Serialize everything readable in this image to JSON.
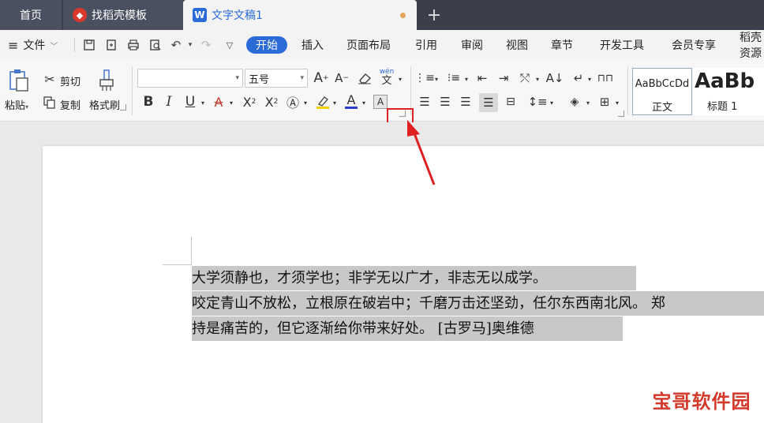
{
  "tabs": {
    "home": "首页",
    "templates": "找稻壳模板",
    "document": "文字文稿1",
    "add": "+"
  },
  "menu": {
    "file": "文件",
    "items": [
      "开始",
      "插入",
      "页面布局",
      "引用",
      "审阅",
      "视图",
      "章节",
      "开发工具",
      "会员专享",
      "稻壳资源"
    ]
  },
  "ribbon": {
    "paste": "粘贴",
    "cut": "剪切",
    "copy": "复制",
    "format_painter": "格式刷",
    "font_name": "",
    "font_size": "五号",
    "pinyin": "wén",
    "styles": [
      {
        "sample": "AaBbCcDd",
        "label": "正文"
      },
      {
        "sample": "AaBb",
        "label": "标题 1"
      }
    ]
  },
  "document": {
    "lines": [
      "大学须静也，才须学也；非学无以广才，非志无以成学。",
      "咬定青山不放松，立根原在破岩中；千磨万击还坚劲，任尔东西南北风。 郑",
      "持是痛苦的，但它逐渐给你带来好处。 [古罗马]奥维德"
    ]
  },
  "watermark": "宝哥软件园",
  "colors": {
    "accent": "#2a6bd8",
    "tabbar": "#3a3f4b",
    "highlight": "#c8c8c8",
    "annotation": "#e02020"
  }
}
